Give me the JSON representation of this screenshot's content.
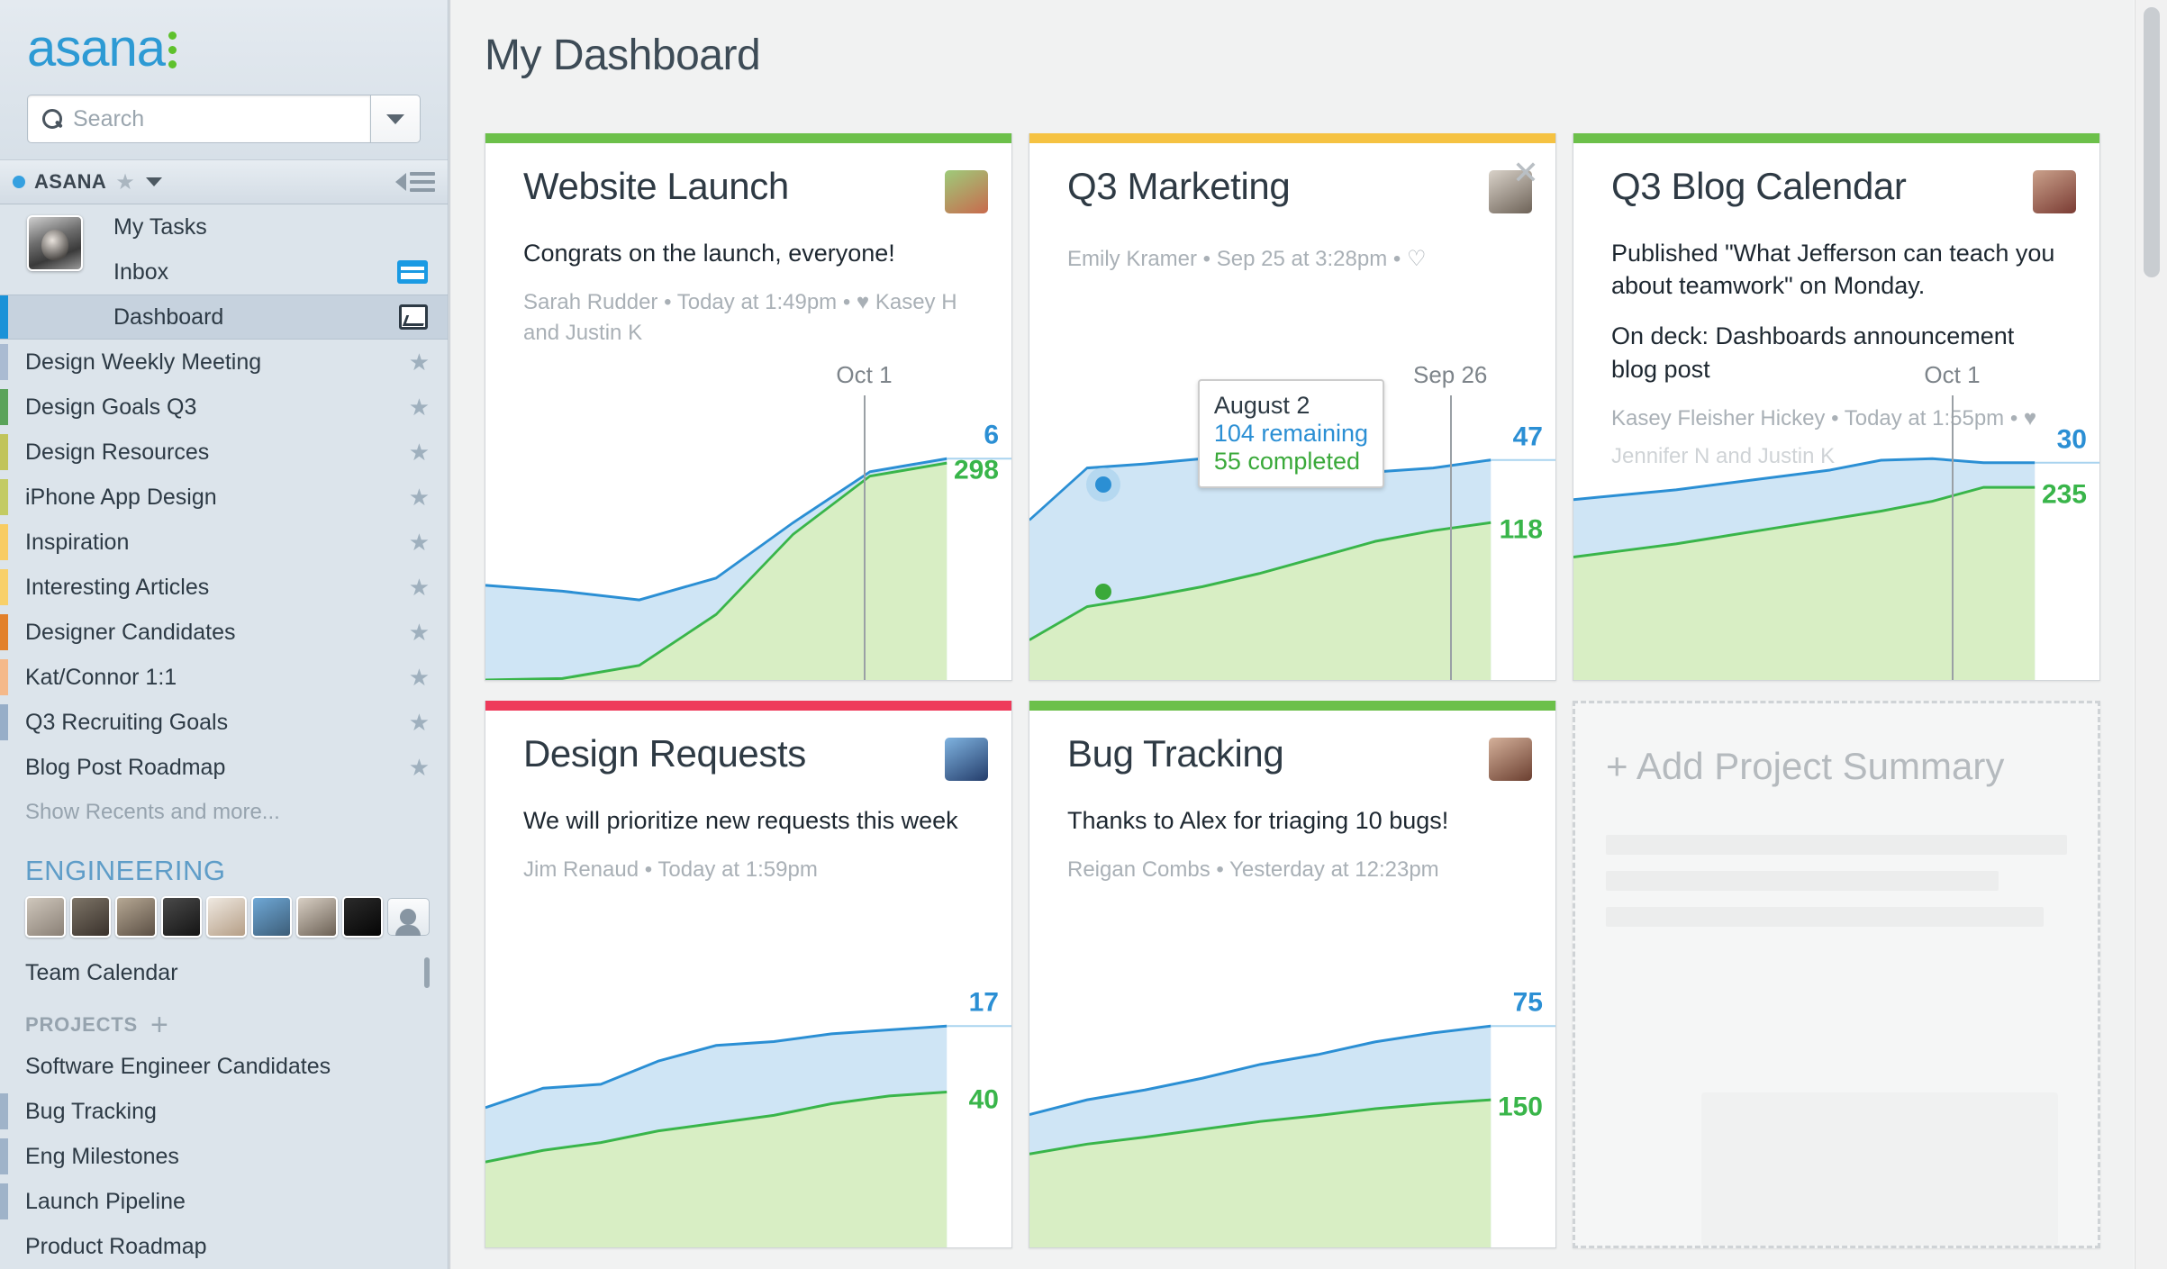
{
  "sidebar": {
    "logo_text": "asana",
    "search": {
      "placeholder": "Search",
      "value": ""
    },
    "org": {
      "name": "ASANA",
      "star": "★"
    },
    "nav": [
      {
        "label": "My Tasks",
        "icon": "",
        "selected": false
      },
      {
        "label": "Inbox",
        "icon": "inbox-icon",
        "selected": false
      },
      {
        "label": "Dashboard",
        "icon": "dashboard-icon",
        "selected": true
      }
    ],
    "projects": [
      {
        "label": "Design Weekly Meeting",
        "color": "#aabbd2",
        "starred": true
      },
      {
        "label": "Design Goals Q3",
        "color": "#5aa35a",
        "starred": true
      },
      {
        "label": "Design Resources",
        "color": "#c1c45a",
        "starred": true
      },
      {
        "label": "iPhone App Design",
        "color": "#c3cb63",
        "starred": true
      },
      {
        "label": "Inspiration",
        "color": "#f8cc63",
        "starred": true
      },
      {
        "label": "Interesting Articles",
        "color": "#f8d06a",
        "starred": true
      },
      {
        "label": "Designer Candidates",
        "color": "#e2802a",
        "starred": true
      },
      {
        "label": "Kat/Connor 1:1",
        "color": "#f5b98a",
        "starred": true
      },
      {
        "label": "Q3 Recruiting Goals",
        "color": "#97aec8",
        "starred": true
      },
      {
        "label": "Blog Post Roadmap",
        "color": "transparent",
        "starred": true
      }
    ],
    "show_more": "Show Recents and more...",
    "team": {
      "name": "ENGINEERING",
      "calendar_label": "Team Calendar",
      "avatar_count": 8
    },
    "projects_header": "PROJECTS",
    "team_projects": [
      {
        "label": "Software Engineer Candidates",
        "color": "transparent"
      },
      {
        "label": "Bug Tracking",
        "color": "#9fb3c9"
      },
      {
        "label": "Eng Milestones",
        "color": "#9fb3c9"
      },
      {
        "label": "Launch Pipeline",
        "color": "#9fb3c9"
      },
      {
        "label": "Product Roadmap",
        "color": "transparent"
      }
    ]
  },
  "header": {
    "title": "My Dashboard"
  },
  "colors": {
    "blue_line": "#2b8fd4",
    "blue_fill": "#cfe5f5",
    "green_line": "#39b54a",
    "green_fill": "#d8eec4",
    "accent_blue": "#1a92d8"
  },
  "cards": [
    {
      "id": "website-launch",
      "title": "Website Launch",
      "top_color": "#6cc04a",
      "closable": false,
      "status_lines": [
        "Congrats on the launch, everyone!"
      ],
      "meta": "Sarah Rudder  •  Today at 1:49pm  •  ♥ Kasey H and Justin K",
      "chart_data": {
        "type": "area",
        "title": "Website Launch",
        "series": [
          {
            "name": "remaining",
            "color": "#2b8fd4",
            "values": [
              130,
              120,
              90,
              50,
              16,
              6,
              6
            ]
          },
          {
            "name": "completed",
            "color": "#39b54a",
            "values": [
              0,
              2,
              20,
              90,
              200,
              280,
              298
            ]
          }
        ],
        "x": [
          "",
          "",
          "",
          "",
          "",
          "Oct 1",
          ""
        ],
        "marker_label": "Oct 1",
        "end_labels": {
          "remaining": "6",
          "completed": "298"
        }
      }
    },
    {
      "id": "q3-marketing",
      "title": "Q3 Marketing",
      "top_color": "#f5c242",
      "closable": true,
      "close_label": "✕",
      "status_lines": [],
      "meta": "Emily Kramer  •  Sep 25 at 3:28pm  •  ♡",
      "tooltip": {
        "date": "August 2",
        "remaining": "104 remaining",
        "completed": "55 completed"
      },
      "chart_data": {
        "type": "area",
        "title": "Q3 Marketing",
        "series": [
          {
            "name": "remaining",
            "color": "#2b8fd4",
            "values": [
              90,
              104,
              100,
              96,
              80,
              62,
              52,
              47,
              47
            ]
          },
          {
            "name": "completed",
            "color": "#39b54a",
            "values": [
              30,
              55,
              62,
              70,
              80,
              92,
              104,
              112,
              118
            ]
          }
        ],
        "x": [
          "",
          "August 2",
          "",
          "",
          "",
          "",
          "",
          "Sep 26",
          ""
        ],
        "marker_label": "Sep 26",
        "end_labels": {
          "remaining": "47",
          "completed": "118"
        }
      }
    },
    {
      "id": "q3-blog-calendar",
      "title": "Q3 Blog Calendar",
      "top_color": "#6cc04a",
      "closable": false,
      "status_lines": [
        "Published \"What Jefferson can teach you about teamwork\" on Monday.",
        "On deck: Dashboards announcement blog post"
      ],
      "meta": "Kasey Fleisher Hickey  •  Today at 1:55pm  •  ♥",
      "meta2": "Jennifer N and Justin K",
      "chart_data": {
        "type": "area",
        "title": "Q3 Blog Calendar",
        "series": [
          {
            "name": "remaining",
            "color": "#2b8fd4",
            "values": [
              70,
              68,
              66,
              64,
              62,
              60,
              62,
              52,
              30,
              30
            ]
          },
          {
            "name": "completed",
            "color": "#39b54a",
            "values": [
              150,
              158,
              166,
              176,
              186,
              196,
              206,
              218,
              235,
              235
            ]
          }
        ],
        "x": [
          "",
          "",
          "",
          "",
          "",
          "",
          "",
          "",
          "Oct 1",
          ""
        ],
        "marker_label": "Oct 1",
        "end_labels": {
          "remaining": "30",
          "completed": "235"
        }
      }
    },
    {
      "id": "design-requests",
      "title": "Design Requests",
      "top_color": "#ee3b5b",
      "closable": false,
      "status_lines": [
        "We will prioritize new requests this week"
      ],
      "meta": "Jim Renaud  •  Today at 1:59pm",
      "chart_data": {
        "type": "area",
        "title": "Design Requests",
        "series": [
          {
            "name": "remaining",
            "color": "#2b8fd4",
            "values": [
              14,
              16,
              15,
              18,
              20,
              19,
              18,
              17,
              17
            ]
          },
          {
            "name": "completed",
            "color": "#39b54a",
            "values": [
              22,
              25,
              27,
              30,
              32,
              34,
              37,
              39,
              40
            ]
          }
        ],
        "x": [
          "",
          "",
          "",
          "",
          "",
          "",
          "",
          "",
          ""
        ],
        "marker_label": "",
        "end_labels": {
          "remaining": "17",
          "completed": "40"
        }
      }
    },
    {
      "id": "bug-tracking",
      "title": "Bug Tracking",
      "top_color": "#6cc04a",
      "closable": false,
      "status_lines": [
        "Thanks to Alex for triaging 10 bugs!"
      ],
      "meta": "Reigan Combs  •  Yesterday at 12:23pm",
      "chart_data": {
        "type": "area",
        "title": "Bug Tracking",
        "series": [
          {
            "name": "remaining",
            "color": "#2b8fd4",
            "values": [
              40,
              45,
              48,
              52,
              58,
              62,
              68,
              72,
              75
            ]
          },
          {
            "name": "completed",
            "color": "#39b54a",
            "values": [
              95,
              105,
              112,
              120,
              128,
              134,
              141,
              146,
              150
            ]
          }
        ],
        "x": [
          "",
          "",
          "",
          "",
          "",
          "",
          "",
          "",
          ""
        ],
        "marker_label": "",
        "end_labels": {
          "remaining": "75",
          "completed": "150"
        }
      }
    }
  ],
  "add_card": {
    "label": "+ Add Project Summary"
  }
}
